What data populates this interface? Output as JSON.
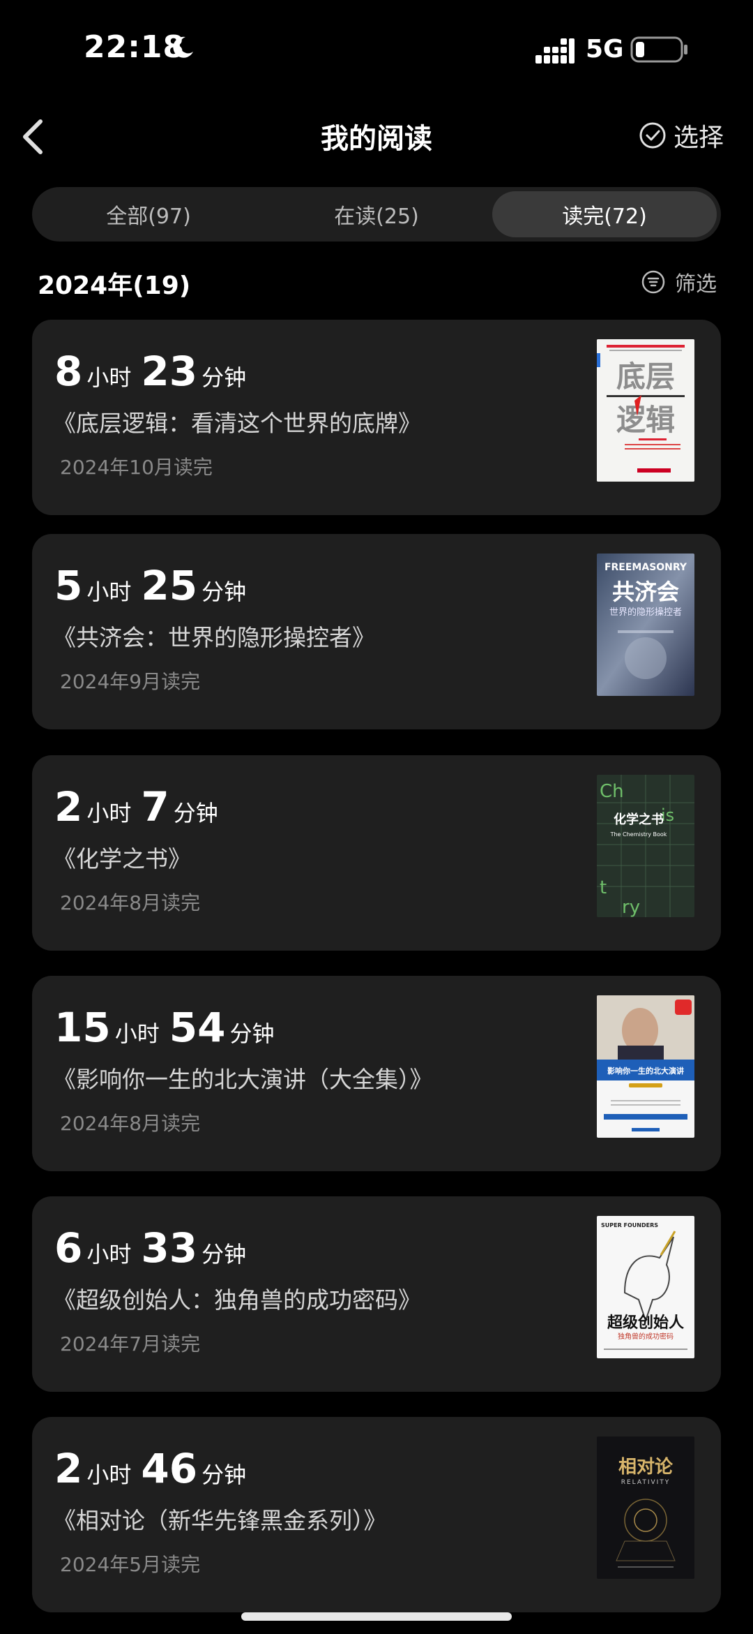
{
  "status_bar": {
    "time": "22:18",
    "network": "5G"
  },
  "nav": {
    "title": "我的阅读",
    "select_label": "选择"
  },
  "tabs": [
    {
      "label": "全部(97)",
      "active": false
    },
    {
      "label": "在读(25)",
      "active": false
    },
    {
      "label": "读完(72)",
      "active": true
    }
  ],
  "section": {
    "year_title": "2024年(19)",
    "filter_label": "筛选"
  },
  "units": {
    "hours": "小时",
    "minutes": "分钟"
  },
  "books": [
    {
      "hours": "8",
      "minutes": "23",
      "title": "《底层逻辑：看清这个世界的底牌》",
      "finished": "2024年10月读完",
      "cover_text": [
        "底层",
        "逻辑"
      ]
    },
    {
      "hours": "5",
      "minutes": "25",
      "title": "《共济会：世界的隐形操控者》",
      "finished": "2024年9月读完",
      "cover_text": [
        "FREEMASONRY",
        "共济会",
        "世界的隐形操控者"
      ]
    },
    {
      "hours": "2",
      "minutes": "7",
      "title": "《化学之书》",
      "finished": "2024年8月读完",
      "cover_text": [
        "化学之书",
        "The Chemistry Book"
      ]
    },
    {
      "hours": "15",
      "minutes": "54",
      "title": "《影响你一生的北大演讲（大全集）》",
      "finished": "2024年8月读完",
      "cover_text": [
        "影响你一生的北大演讲"
      ]
    },
    {
      "hours": "6",
      "minutes": "33",
      "title": "《超级创始人：独角兽的成功密码》",
      "finished": "2024年7月读完",
      "cover_text": [
        "SUPER FOUNDERS",
        "超级创始人",
        "独角兽的成功密码"
      ]
    },
    {
      "hours": "2",
      "minutes": "46",
      "title": "《相对论（新华先锋黑金系列）》",
      "finished": "2024年5月读完",
      "cover_text": [
        "相对论",
        "RELATIVITY"
      ]
    }
  ],
  "colors": {
    "background": "#000000",
    "card": "#1f1f1f",
    "muted_text": "#8a8a8a",
    "active_tab": "#3a3a3a"
  }
}
